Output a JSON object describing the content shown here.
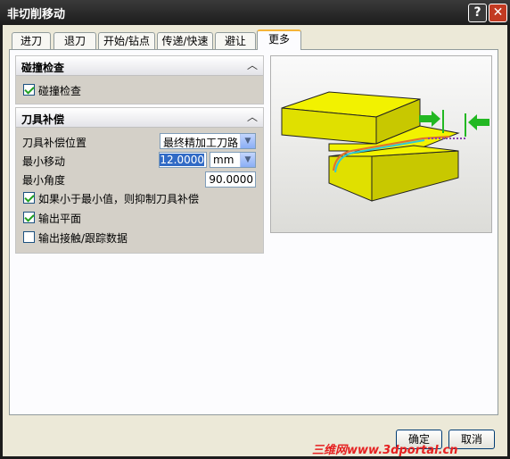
{
  "window": {
    "title": "非切削移动",
    "help_icon": "?",
    "close_icon": "✕"
  },
  "tabs": [
    {
      "label": "进刀"
    },
    {
      "label": "退刀"
    },
    {
      "label": "开始/钻点"
    },
    {
      "label": "传递/快速"
    },
    {
      "label": "避让"
    },
    {
      "label": "更多",
      "active": true
    }
  ],
  "collision": {
    "title": "碰撞检查",
    "checkbox_label": "碰撞检查",
    "checked": true
  },
  "cutter_comp": {
    "title": "刀具补偿",
    "position_label": "刀具补偿位置",
    "position_value": "最终精加工刀路",
    "min_move_label": "最小移动",
    "min_move_value": "12.0000",
    "min_move_unit": "mm",
    "min_angle_label": "最小角度",
    "min_angle_value": "90.0000",
    "suppress_label": "如果小于最小值，则抑制刀具补偿",
    "suppress_checked": true,
    "output_plane_label": "输出平面",
    "output_plane_checked": true,
    "output_contact_label": "输出接触/跟踪数据",
    "output_contact_checked": false
  },
  "footer": {
    "ok_label": "确定",
    "cancel_label": "取消",
    "watermark": "三维网www.3dportal.cn"
  },
  "colors": {
    "accent": "#f5b438",
    "block_top": "#f2f200",
    "block_side": "#c8c800",
    "arrow": "#22b822"
  }
}
